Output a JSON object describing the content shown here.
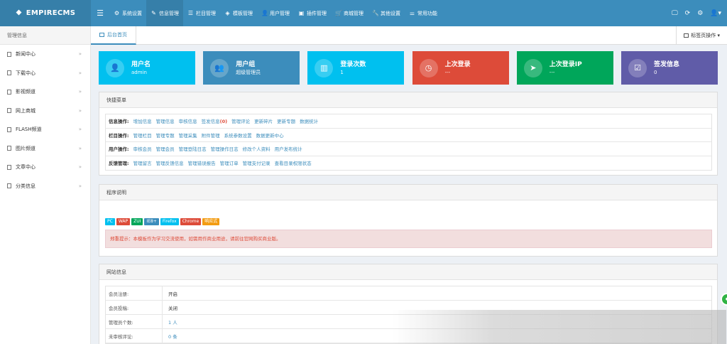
{
  "app": {
    "logo": "EMPIRECMS"
  },
  "nav": [
    {
      "icon": "gear-icon",
      "glyph": "⚙",
      "label": "系统设置"
    },
    {
      "icon": "edit-icon",
      "glyph": "✎",
      "label": "信息管理"
    },
    {
      "icon": "list-icon",
      "glyph": "☰",
      "label": "栏目管理"
    },
    {
      "icon": "layers-icon",
      "glyph": "◈",
      "label": "模板管理"
    },
    {
      "icon": "user-icon",
      "glyph": "👤",
      "label": "用户管理"
    },
    {
      "icon": "file-icon",
      "glyph": "▣",
      "label": "插件管理"
    },
    {
      "icon": "cart-icon",
      "glyph": "🛒",
      "label": "商城管理"
    },
    {
      "icon": "wrench-icon",
      "glyph": "🔧",
      "label": "其他设置"
    },
    {
      "icon": "sliders-icon",
      "glyph": "⚌",
      "label": "常用功能"
    }
  ],
  "sidebar": {
    "title": "管理信息",
    "items": [
      {
        "label": "新闻中心"
      },
      {
        "label": "下载中心"
      },
      {
        "label": "影视频道"
      },
      {
        "label": "网上商城"
      },
      {
        "label": "FLASH频道"
      },
      {
        "label": "图片频道"
      },
      {
        "label": "文章中心"
      },
      {
        "label": "分类信息"
      }
    ],
    "arrow": "»"
  },
  "tabs": {
    "home": "后台首页",
    "ops": "标签页操作"
  },
  "stats": [
    {
      "title": "用户名",
      "value": "admin",
      "color": "#00c0ef",
      "icon": "user-icon",
      "glyph": "👤"
    },
    {
      "title": "用户组",
      "value": "超级管理员",
      "color": "#3c8dbc",
      "icon": "users-icon",
      "glyph": "👥"
    },
    {
      "title": "登录次数",
      "value": "1",
      "color": "#00c0ef",
      "icon": "chart-icon",
      "glyph": "▥"
    },
    {
      "title": "上次登录",
      "value": "---",
      "color": "#dd4b39",
      "icon": "clock-icon",
      "glyph": "◷"
    },
    {
      "title": "上次登录IP",
      "value": "---",
      "color": "#00a65a",
      "icon": "location-arrow-icon",
      "glyph": "➤"
    },
    {
      "title": "签发信息",
      "value": "0",
      "color": "#605ca8",
      "icon": "checkbox-icon",
      "glyph": "☑"
    }
  ],
  "quick": {
    "title": "快捷菜单",
    "rows": [
      {
        "label": "信息操作:",
        "links": [
          "增加信息",
          "管理信息",
          "审核信息",
          "签发信息",
          "管理评论",
          "更新碎片",
          "更新专题",
          "数据统计"
        ],
        "badge": "(0)"
      },
      {
        "label": "栏目操作:",
        "links": [
          "管理栏目",
          "管理专题",
          "管理采集",
          "附件管理",
          "系统参数设置",
          "数据更新中心"
        ]
      },
      {
        "label": "用户操作:",
        "links": [
          "审核会员",
          "管理会员",
          "管理登陆日志",
          "管理操作日志",
          "修改个人资料",
          "用户发布统计"
        ]
      },
      {
        "label": "反馈管理:",
        "links": [
          "管理留言",
          "管理反馈信息",
          "管理错误报告",
          "管理订单",
          "管理支付记录",
          "查看目录权限状态"
        ]
      }
    ]
  },
  "program": {
    "title": "程序说明",
    "badges": [
      {
        "text": "PC",
        "color": "#00c0ef"
      },
      {
        "text": "WAP",
        "color": "#dd4b39"
      },
      {
        "text": "ZUI",
        "color": "#00a65a"
      },
      {
        "text": "IE8+",
        "color": "#3c8dbc"
      },
      {
        "text": "Firefox",
        "color": "#00c0ef"
      },
      {
        "text": "Chrome",
        "color": "#dd4b39"
      },
      {
        "text": "响应式",
        "color": "#f39c12"
      }
    ],
    "notice": "郑重提示：本模板作为学习交流使用，如需用作商业用途，请前往官网购买商业版。"
  },
  "site": {
    "title": "网站信息",
    "rows": [
      {
        "k": "会员注册:",
        "v": "开启"
      },
      {
        "k": "会员投稿:",
        "v": "关闭"
      },
      {
        "k": "管理员个数:",
        "v": "1 人"
      },
      {
        "k": "未审核评论:",
        "v": "0 条"
      }
    ]
  }
}
